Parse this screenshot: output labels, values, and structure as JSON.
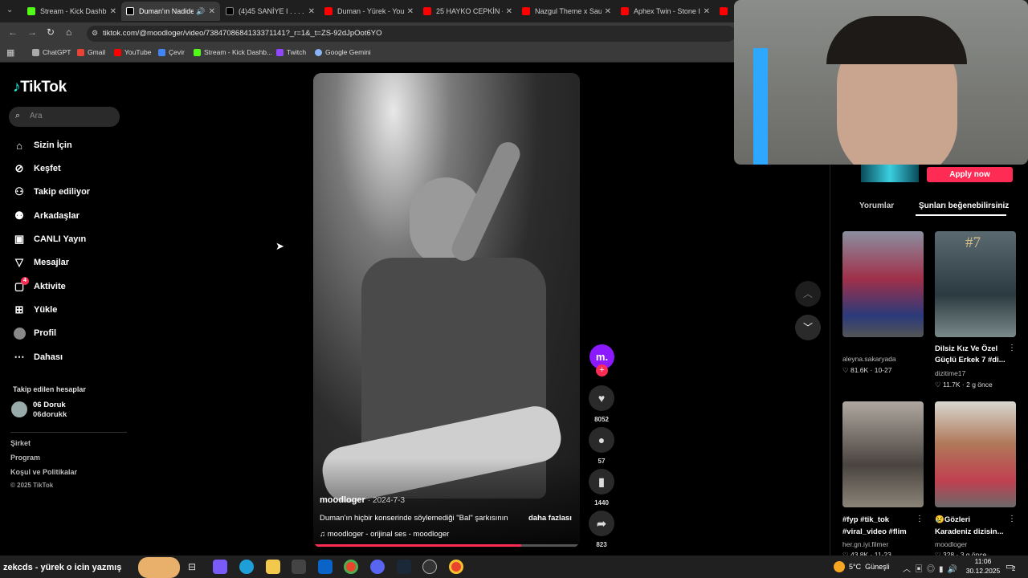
{
  "browser": {
    "tabs": [
      {
        "title": "Stream - Kick Dashb...",
        "color": "#53fc18"
      },
      {
        "title": "Duman'ın Nadide",
        "color": "#000000",
        "active": true
      },
      {
        "title": "(4)45 SANİYE I . . . . .",
        "color": "#000000"
      },
      {
        "title": "Duman - Yürek - You",
        "color": "#ff0000"
      },
      {
        "title": "25 HAYKO CEPKİN - F",
        "color": "#ff0000"
      },
      {
        "title": "Nazgul Theme x Sau",
        "color": "#ff0000"
      },
      {
        "title": "Aphex Twin - Stone I",
        "color": "#ff0000"
      },
      {
        "title": "T",
        "color": "#ff0000"
      }
    ],
    "url": "tiktok.com/@moodloger/video/7384708684133371141?_r=1&_t=ZS-92dJpOot6YO",
    "bookmarks": [
      {
        "label": "ChatGPT",
        "color": "#aaaaaa"
      },
      {
        "label": "Gmail",
        "color": "#ea4335"
      },
      {
        "label": "YouTube",
        "color": "#ff0000"
      },
      {
        "label": "Çevir",
        "color": "#4285f4"
      },
      {
        "label": "Stream - Kick Dashb...",
        "color": "#53fc18"
      },
      {
        "label": "Twitch",
        "color": "#9146ff"
      },
      {
        "label": "Google Gemini",
        "color": "#8ab4f8"
      }
    ]
  },
  "sidebar": {
    "logo": "TikTok",
    "search_placeholder": "Ara",
    "nav": [
      {
        "label": "Sizin İçin",
        "icon": "home-icon"
      },
      {
        "label": "Keşfet",
        "icon": "compass-icon"
      },
      {
        "label": "Takip ediliyor",
        "icon": "user-follow-icon"
      },
      {
        "label": "Arkadaşlar",
        "icon": "friends-icon"
      },
      {
        "label": "CANLI Yayın",
        "icon": "live-icon"
      },
      {
        "label": "Mesajlar",
        "icon": "message-icon"
      },
      {
        "label": "Aktivite",
        "icon": "activity-icon",
        "badge": "4"
      },
      {
        "label": "Yükle",
        "icon": "upload-icon"
      },
      {
        "label": "Profil",
        "icon": "profile-icon"
      },
      {
        "label": "Dahası",
        "icon": "more-icon"
      }
    ],
    "following_title": "Takip edilen hesaplar",
    "following": {
      "name": "06 Doruk",
      "handle": "06dorukk"
    },
    "footer": [
      "Şirket",
      "Program",
      "Koşul ve Politikalar",
      "© 2025 TikTok"
    ]
  },
  "video": {
    "author": "moodloger",
    "date": "· 2024-7-3",
    "caption": "Duman'ın hiçbir konserinde söylemediği \"Bal\" şarkısının",
    "more": "daha fazlası",
    "sound": "moodloger - orijinal ses - moodloger",
    "progress": 0.78,
    "avatar_glyph": "m.",
    "likes": "8052",
    "comments": "57",
    "saves": "1440",
    "shares": "823"
  },
  "right_panel": {
    "apply_label": "Apply now",
    "tab_comments": "Yorumlar",
    "tab_recommended": "Şunları beğenebilirsiniz",
    "cards": [
      {
        "caption1": "",
        "caption2": "",
        "user": "aleyna.sakaryada",
        "stats": "♡ 81.6K · 10-27"
      },
      {
        "caption1": "Dilsiz Kız Ve Özel",
        "caption2": "Güçlü Erkek 7 #di...",
        "user": "dizitime17",
        "stats": "♡ 11.7K · 2 g önce",
        "overlay": "#7"
      },
      {
        "caption1": "#fyp #tik_tok",
        "caption2": "#viral_video #flim",
        "user": "her.gn.iyi.filmer",
        "stats": "♡ 43.8K · 11-23"
      },
      {
        "caption1": "😢Gözleri",
        "caption2": "Karadeniz dizisin...",
        "user": "moodloger",
        "stats": "♡ 328 · 3 g önce"
      }
    ]
  },
  "taskbar": {
    "search_text": "zekcds - yürek o icin yazmış",
    "weather": "5°C  Güneşli",
    "time": "11:06",
    "date": "30.12.2025",
    "notif": "2"
  }
}
